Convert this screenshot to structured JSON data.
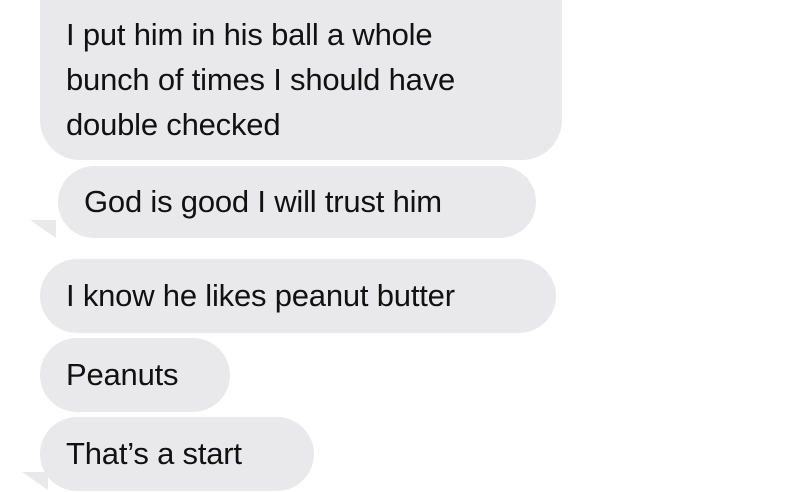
{
  "messages": [
    {
      "text": "I put him in his ball a whole\nbunch of times I should have\ndouble checked"
    },
    {
      "text": "God is good I will trust him"
    },
    {
      "text": "I know he likes peanut butter"
    },
    {
      "text": "Peanuts"
    },
    {
      "text": "That’s a start"
    }
  ],
  "colors": {
    "received_bubble": "#e9e9eb",
    "text": "#111111",
    "background": "#ffffff"
  }
}
